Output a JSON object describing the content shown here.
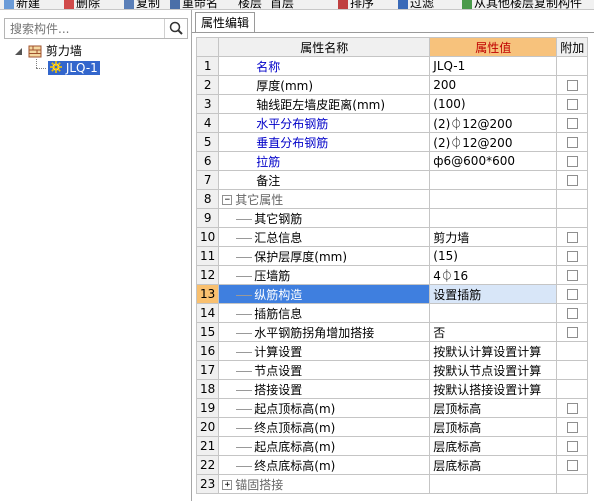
{
  "toolbar": {
    "items": [
      "新建",
      "删除",
      "复制",
      "重命名",
      "楼层",
      "首层",
      "排序",
      "过滤",
      "从其他楼层复制构件"
    ]
  },
  "search": {
    "placeholder": "搜索构件..."
  },
  "tree": {
    "root_label": "剪力墙",
    "child_label": "JLQ-1"
  },
  "tab": {
    "label": "属性编辑"
  },
  "grid": {
    "headers": {
      "num": "",
      "name": "属性名称",
      "value": "属性值",
      "extra": "附加"
    },
    "rows": [
      {
        "n": "1",
        "name": "名称",
        "value": "JLQ-1",
        "blue": true,
        "cb": false
      },
      {
        "n": "2",
        "name": "厚度(mm)",
        "value": "200",
        "cb": true
      },
      {
        "n": "3",
        "name": "轴线距左墙皮距离(mm)",
        "value": "(100)",
        "cb": true
      },
      {
        "n": "4",
        "name": "水平分布钢筋",
        "value": "(2)⏀12@200",
        "blue": true,
        "cb": true
      },
      {
        "n": "5",
        "name": "垂直分布钢筋",
        "value": "(2)⏀12@200",
        "blue": true,
        "cb": true
      },
      {
        "n": "6",
        "name": "拉筋",
        "value": "ф6@600*600",
        "blue": true,
        "cb": true
      },
      {
        "n": "7",
        "name": "备注",
        "value": "",
        "cb": true
      },
      {
        "n": "8",
        "name": "其它属性",
        "value": "",
        "group": true,
        "toggle": "−"
      },
      {
        "n": "9",
        "name": "其它钢筋",
        "value": "",
        "child": true
      },
      {
        "n": "10",
        "name": "汇总信息",
        "value": "剪力墙",
        "child": true,
        "cb": true
      },
      {
        "n": "11",
        "name": "保护层厚度(mm)",
        "value": "(15)",
        "child": true,
        "cb": true
      },
      {
        "n": "12",
        "name": "压墙筋",
        "value": "4⏀16",
        "child": true,
        "cb": true
      },
      {
        "n": "13",
        "name": "纵筋构造",
        "value": "设置插筋",
        "child": true,
        "cb": true,
        "highlight": true
      },
      {
        "n": "14",
        "name": "插筋信息",
        "value": "",
        "child": true,
        "cb": true
      },
      {
        "n": "15",
        "name": "水平钢筋拐角增加搭接",
        "value": "否",
        "child": true,
        "cb": true
      },
      {
        "n": "16",
        "name": "计算设置",
        "value": "按默认计算设置计算",
        "child": true
      },
      {
        "n": "17",
        "name": "节点设置",
        "value": "按默认节点设置计算",
        "child": true
      },
      {
        "n": "18",
        "name": "搭接设置",
        "value": "按默认搭接设置计算",
        "child": true
      },
      {
        "n": "19",
        "name": "起点顶标高(m)",
        "value": "层顶标高",
        "child": true,
        "cb": true
      },
      {
        "n": "20",
        "name": "终点顶标高(m)",
        "value": "层顶标高",
        "child": true,
        "cb": true
      },
      {
        "n": "21",
        "name": "起点底标高(m)",
        "value": "层底标高",
        "child": true,
        "cb": true
      },
      {
        "n": "22",
        "name": "终点底标高(m)",
        "value": "层底标高",
        "child": true,
        "cb": true
      },
      {
        "n": "23",
        "name": "锚固搭接",
        "value": "",
        "group": true,
        "toggle": "+"
      }
    ]
  }
}
